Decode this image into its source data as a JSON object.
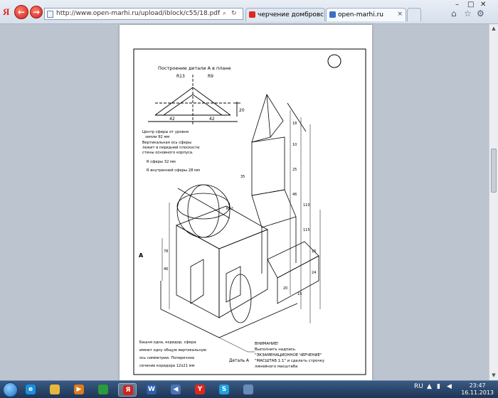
{
  "browser": {
    "logo": "Я",
    "address_url": "http://www.open-marhi.ru/upload/iblock/c55/18.pdf",
    "tabs": [
      {
        "title": "черчение домбровский — Ян",
        "close": "×"
      },
      {
        "title": "open-marhi.ru",
        "close": "×"
      }
    ],
    "window_controls": [
      "–",
      "□",
      "✕"
    ],
    "colors": {
      "accent": "#d0231a",
      "tab_fav_1": "#e0261b",
      "tab_fav_2": "#3a6fc2"
    }
  },
  "drawing": {
    "section_title": "Построение детали А в плане",
    "dims_top": [
      "R13",
      "R9"
    ],
    "dims_bottom": [
      "42",
      "42"
    ],
    "dim_side": "20",
    "note_lines": [
      "Центр сферы от уровня",
      "земли 92 мм",
      "Вертикальная ось сферы",
      "лежит в передней плоскости",
      "стены основного корпуса."
    ],
    "sphere_r": "R сферы 32 мм",
    "sphere_r_inner": "R внутренней сферы 28 мм",
    "section_marker": "А",
    "detail_label": "Деталь А",
    "bottom_left_lines": [
      "Башня одна, коридор, сфера",
      "имеют одну общую вертикальную",
      "ось симметрии. Поперечное",
      "сечение коридора 12x21 мм"
    ],
    "attention_lines": [
      "ВНИМАНИЕ!",
      "Выполнить надпись",
      "\"ЭКЗАМЕНАЦИОННОЕ ЧЕРЧЕНИЕ\"",
      "\"МАСШТАБ 1:1\" и сделать строчку",
      "линейного масштаба"
    ]
  },
  "taskbar": {
    "apps": [
      {
        "icon": "explorer-icon",
        "glyph": "e",
        "color": "#1a8fe0"
      },
      {
        "icon": "folder-icon",
        "glyph": "",
        "color": "#e7b73c"
      },
      {
        "icon": "media-player-icon",
        "glyph": "▶",
        "color": "#e07a1a"
      },
      {
        "icon": "chrome-icon",
        "glyph": "",
        "color": "#2a9a3c"
      },
      {
        "icon": "yandex-browser-icon",
        "glyph": "Я",
        "color": "#d0231a"
      },
      {
        "icon": "word-icon",
        "glyph": "W",
        "color": "#2b5fb0"
      },
      {
        "icon": "sound-icon",
        "glyph": "◀",
        "color": "#4a74b8"
      },
      {
        "icon": "yandex-icon",
        "glyph": "Y",
        "color": "#e0261b"
      },
      {
        "icon": "skype-icon",
        "glyph": "S",
        "color": "#1fa0e0"
      },
      {
        "icon": "window-icon",
        "glyph": "",
        "color": "#6a8ab8"
      }
    ],
    "language": "RU",
    "time": "23:47",
    "date": "16.11.2013"
  }
}
